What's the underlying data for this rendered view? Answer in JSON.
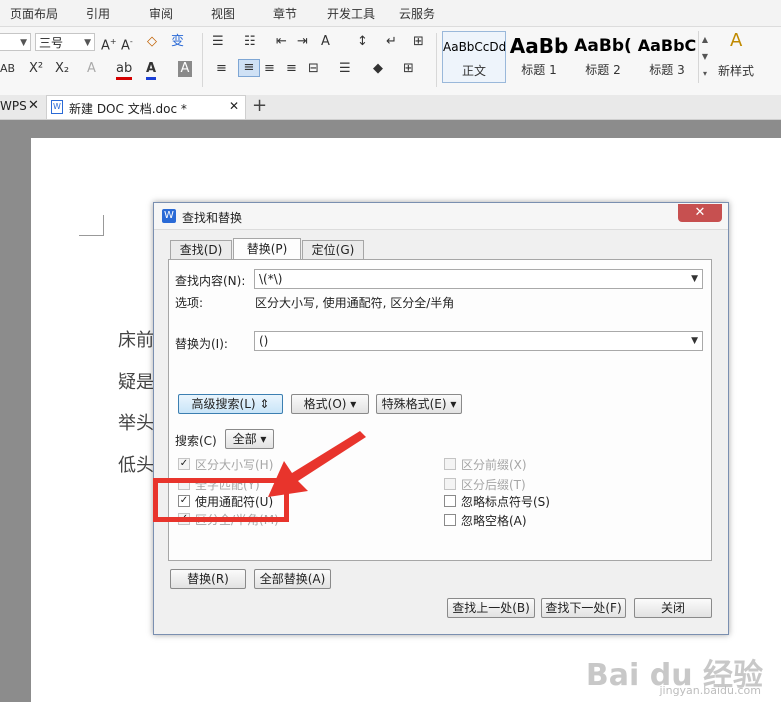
{
  "menubar": [
    "页面布局",
    "引用",
    "审阅",
    "视图",
    "章节",
    "开发工具",
    "云服务"
  ],
  "ribbon": {
    "font_size": "三号",
    "styles": [
      {
        "sample": "AaBbCcDd",
        "name": "正文"
      },
      {
        "sample": "AaBb",
        "name": "标题 1"
      },
      {
        "sample": "AaBb(",
        "name": "标题 2"
      },
      {
        "sample": "AaBbC",
        "name": "标题 3"
      }
    ],
    "new_style": "新样式"
  },
  "tabs": {
    "prev_tab": "WPS",
    "doc_tab": "新建 DOC 文档.doc *"
  },
  "document": {
    "lines": [
      "床前",
      "疑是",
      "举头",
      "低头"
    ]
  },
  "dialog": {
    "title": "查找和替换",
    "tabs": [
      "查找(D)",
      "替换(P)",
      "定位(G)"
    ],
    "find_label": "查找内容(N):",
    "find_value": "\\(*\\)",
    "options_label": "选项:",
    "options_value": "区分大小写, 使用通配符, 区分全/半角",
    "replace_label": "替换为(I):",
    "replace_value": "()",
    "advanced_button": "高级搜索(L)",
    "format_button": "格式(O)",
    "special_button": "特殊格式(E)",
    "search_label": "搜索(C)",
    "search_value": "全部",
    "checks_left": [
      {
        "label": "区分大小写(H)",
        "checked": true,
        "enabled": false
      },
      {
        "label": "全字匹配(Y)",
        "checked": false,
        "enabled": false
      },
      {
        "label": "使用通配符(U)",
        "checked": true,
        "enabled": true
      },
      {
        "label": "区分全/半角(M)",
        "checked": true,
        "enabled": false
      }
    ],
    "checks_right": [
      {
        "label": "区分前缀(X)",
        "checked": false,
        "enabled": false
      },
      {
        "label": "区分后缀(T)",
        "checked": false,
        "enabled": false
      },
      {
        "label": "忽略标点符号(S)",
        "checked": false,
        "enabled": true
      },
      {
        "label": "忽略空格(A)",
        "checked": false,
        "enabled": true
      }
    ],
    "replace_button": "替换(R)",
    "replace_all_button": "全部替换(A)",
    "find_prev_button": "查找上一处(B)",
    "find_next_button": "查找下一处(F)",
    "close_button": "关闭"
  },
  "watermark": {
    "brand": "Bai du 经验",
    "url": "jingyan.baidu.com"
  },
  "colors": {
    "highlight_red": "#e8342c",
    "font_color_red": "#d40000",
    "font_color_blue": "#1a3fd6"
  }
}
